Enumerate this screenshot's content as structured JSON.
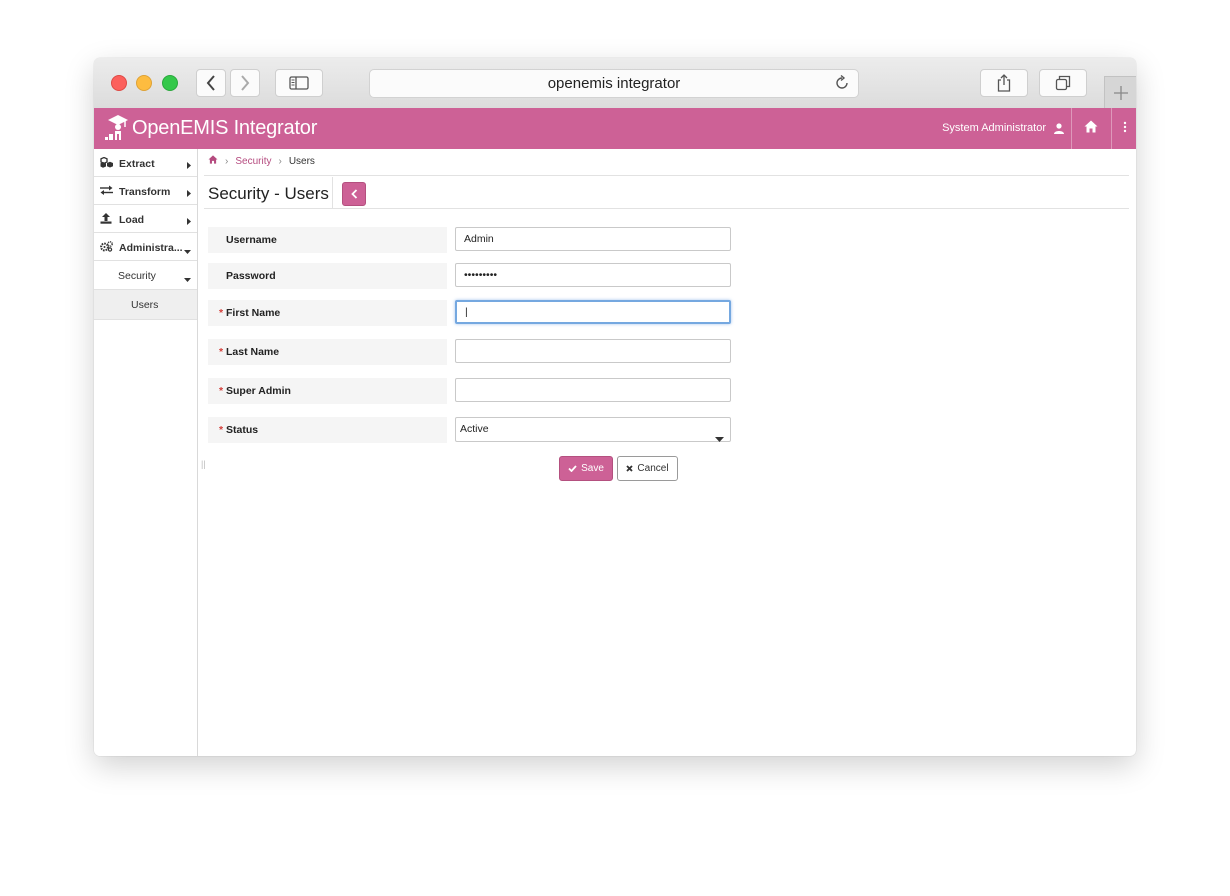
{
  "browser": {
    "url": "openemis integrator"
  },
  "app": {
    "title": "OpenEMIS Integrator",
    "user": "System Administrator",
    "brand_color": "#cd6196"
  },
  "sidebar": {
    "items": [
      {
        "label": "Extract",
        "icon": "cubes-icon"
      },
      {
        "label": "Transform",
        "icon": "exchange-icon"
      },
      {
        "label": "Load",
        "icon": "upload-icon"
      },
      {
        "label": "Administra...",
        "icon": "cogs-icon"
      }
    ],
    "sub_item": "Security",
    "sub_sub_item": "Users"
  },
  "breadcrumb": {
    "section": "Security",
    "current": "Users"
  },
  "page": {
    "title": "Security - Users"
  },
  "form": {
    "username": {
      "label": "Username",
      "value": "Admin"
    },
    "password": {
      "label": "Password",
      "value": "•••••••••"
    },
    "first_name": {
      "label": "First Name",
      "value": "|"
    },
    "last_name": {
      "label": "Last Name",
      "value": ""
    },
    "super_admin": {
      "label": "Super Admin",
      "value": ""
    },
    "status": {
      "label": "Status",
      "value": "Active"
    },
    "required_mark": "*",
    "save_label": "Save",
    "cancel_label": "Cancel"
  }
}
